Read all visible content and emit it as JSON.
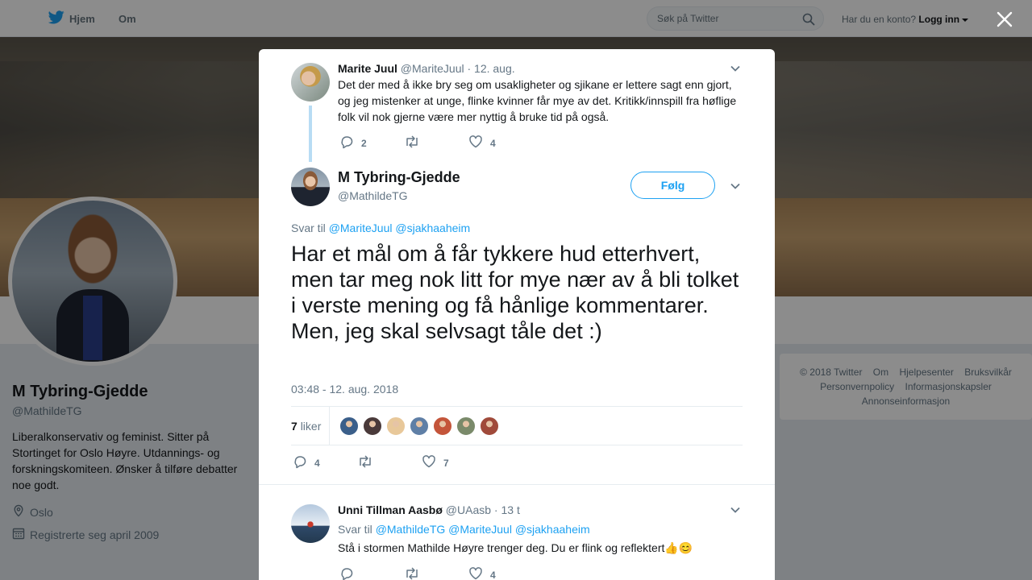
{
  "nav": {
    "home_label": "Hjem",
    "about_label": "Om",
    "search_placeholder": "Søk på Twitter",
    "account_prompt": "Har du en konto?",
    "login_label": "Logg inn"
  },
  "profile": {
    "name": "M Tybring-Gjedde",
    "handle": "@MathildeTG",
    "bio": "Liberalkonservativ og feminist. Sitter på Stortinget for Oslo Høyre. Utdannings- og forskningskomiteen. Ønsker å tilføre debatter noe godt.",
    "location": "Oslo",
    "joined": "Registrerte seg april 2009"
  },
  "footer": {
    "links": [
      "© 2018 Twitter",
      "Om",
      "Hjelpesenter",
      "Bruksvilkår",
      "Personvernpolicy",
      "Informasjonskapsler",
      "Annonseinformasjon"
    ]
  },
  "modal": {
    "parent_tweet": {
      "name": "Marite Juul",
      "handle": "@MariteJuul",
      "date": "12. aug.",
      "text": "Det der med å ikke bry seg om usakligheter og sjikane er lettere sagt enn gjort, og jeg mistenker at unge, flinke kvinner får mye av det. Kritikk/innspill fra høflige folk vil nok gjerne være mer nyttig å bruke tid på også.",
      "replies": "2",
      "retweets": "",
      "likes": "4"
    },
    "main_tweet": {
      "name": "M Tybring-Gjedde",
      "handle": "@MathildeTG",
      "follow_label": "Følg",
      "reply_prefix": "Svar til",
      "reply_handles": "@MariteJuul @sjakhaaheim",
      "text": "Har et mål om å får tykkere hud etterhvert, men tar meg nok litt for mye nær av å bli tolket i verste mening og få hånlige kommentarer. Men, jeg skal selvsagt tåle det :)",
      "timestamp": "03:48 - 12. aug. 2018",
      "like_count": "7",
      "like_word": "liker",
      "liker_colors": [
        "#3b5f8a",
        "#4a3a3a",
        "#e8c89a",
        "#5f7fa6",
        "#c4553a",
        "#7a8a6a",
        "#a04a3a"
      ],
      "replies": "4",
      "retweets": "",
      "likes": "7"
    },
    "reply_tweet": {
      "name": "Unni Tillman Aasbø",
      "handle": "@UAasb",
      "age": "13 t",
      "reply_prefix": "Svar til",
      "reply_handles": "@MathildeTG @MariteJuul @sjakhaaheim",
      "text": "Stå i stormen Mathilde Høyre trenger deg. Du er flink og reflektert👍😊",
      "replies": "",
      "retweets": "",
      "likes": "4"
    }
  },
  "colors": {
    "accent": "#1da1f2",
    "muted": "#657786",
    "text": "#14171a"
  }
}
